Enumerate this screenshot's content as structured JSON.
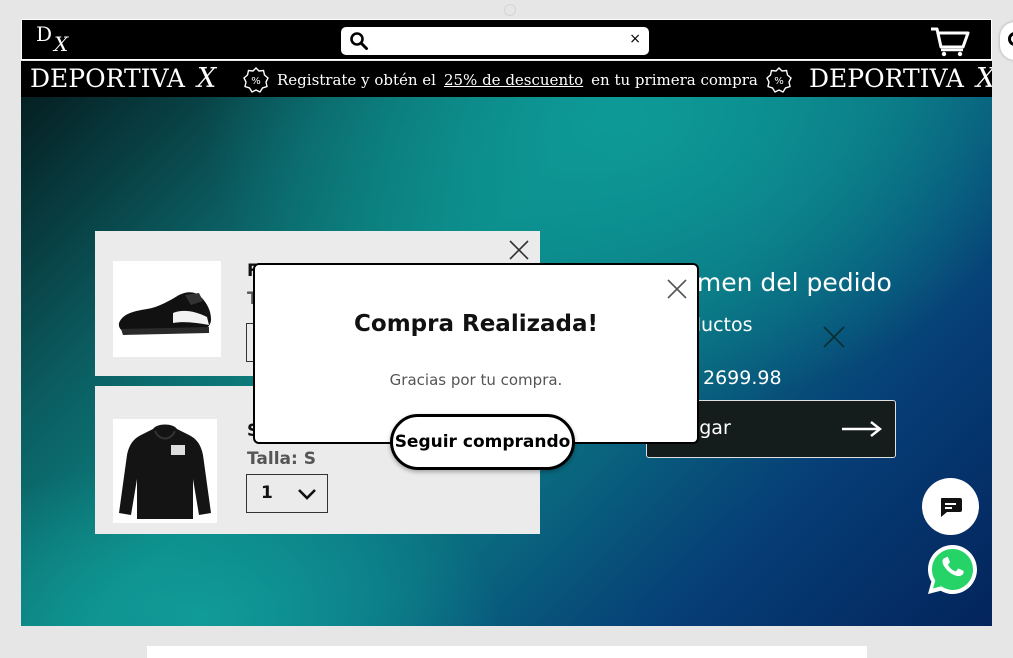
{
  "header": {
    "logo_d": "D",
    "logo_x": "X",
    "search": {
      "value": "",
      "placeholder": "",
      "clear_label": "×"
    },
    "cart_icon": "cart-icon"
  },
  "promo": {
    "brand": "DEPORTIVA",
    "brand_mark": "X",
    "text_before": "Registrate y obtén el",
    "discount_link": "25% de descuento",
    "text_after": "en tu primera compra",
    "percent_icon": "percent-badge-icon"
  },
  "cart": {
    "items": [
      {
        "name": "F",
        "size_label": "T",
        "quantity": "",
        "image": "black-football-boot"
      },
      {
        "name": "S",
        "size_label": "Talla: S",
        "quantity": "1",
        "image": "black-hoodie"
      }
    ]
  },
  "summary": {
    "title": "umen del pedido",
    "count": "ductos",
    "total": "2699.98",
    "pay_label": "Pagar"
  },
  "modal": {
    "title": "Compra Realizada!",
    "message": "Gracias por tu compra.",
    "continue_label": "Seguir comprando"
  },
  "colors": {
    "header_bg": "#000000",
    "hero_teal": "#0c8785",
    "hero_navy": "#04245c",
    "card_bg": "#ebebeb",
    "whatsapp_green": "#25d366"
  }
}
